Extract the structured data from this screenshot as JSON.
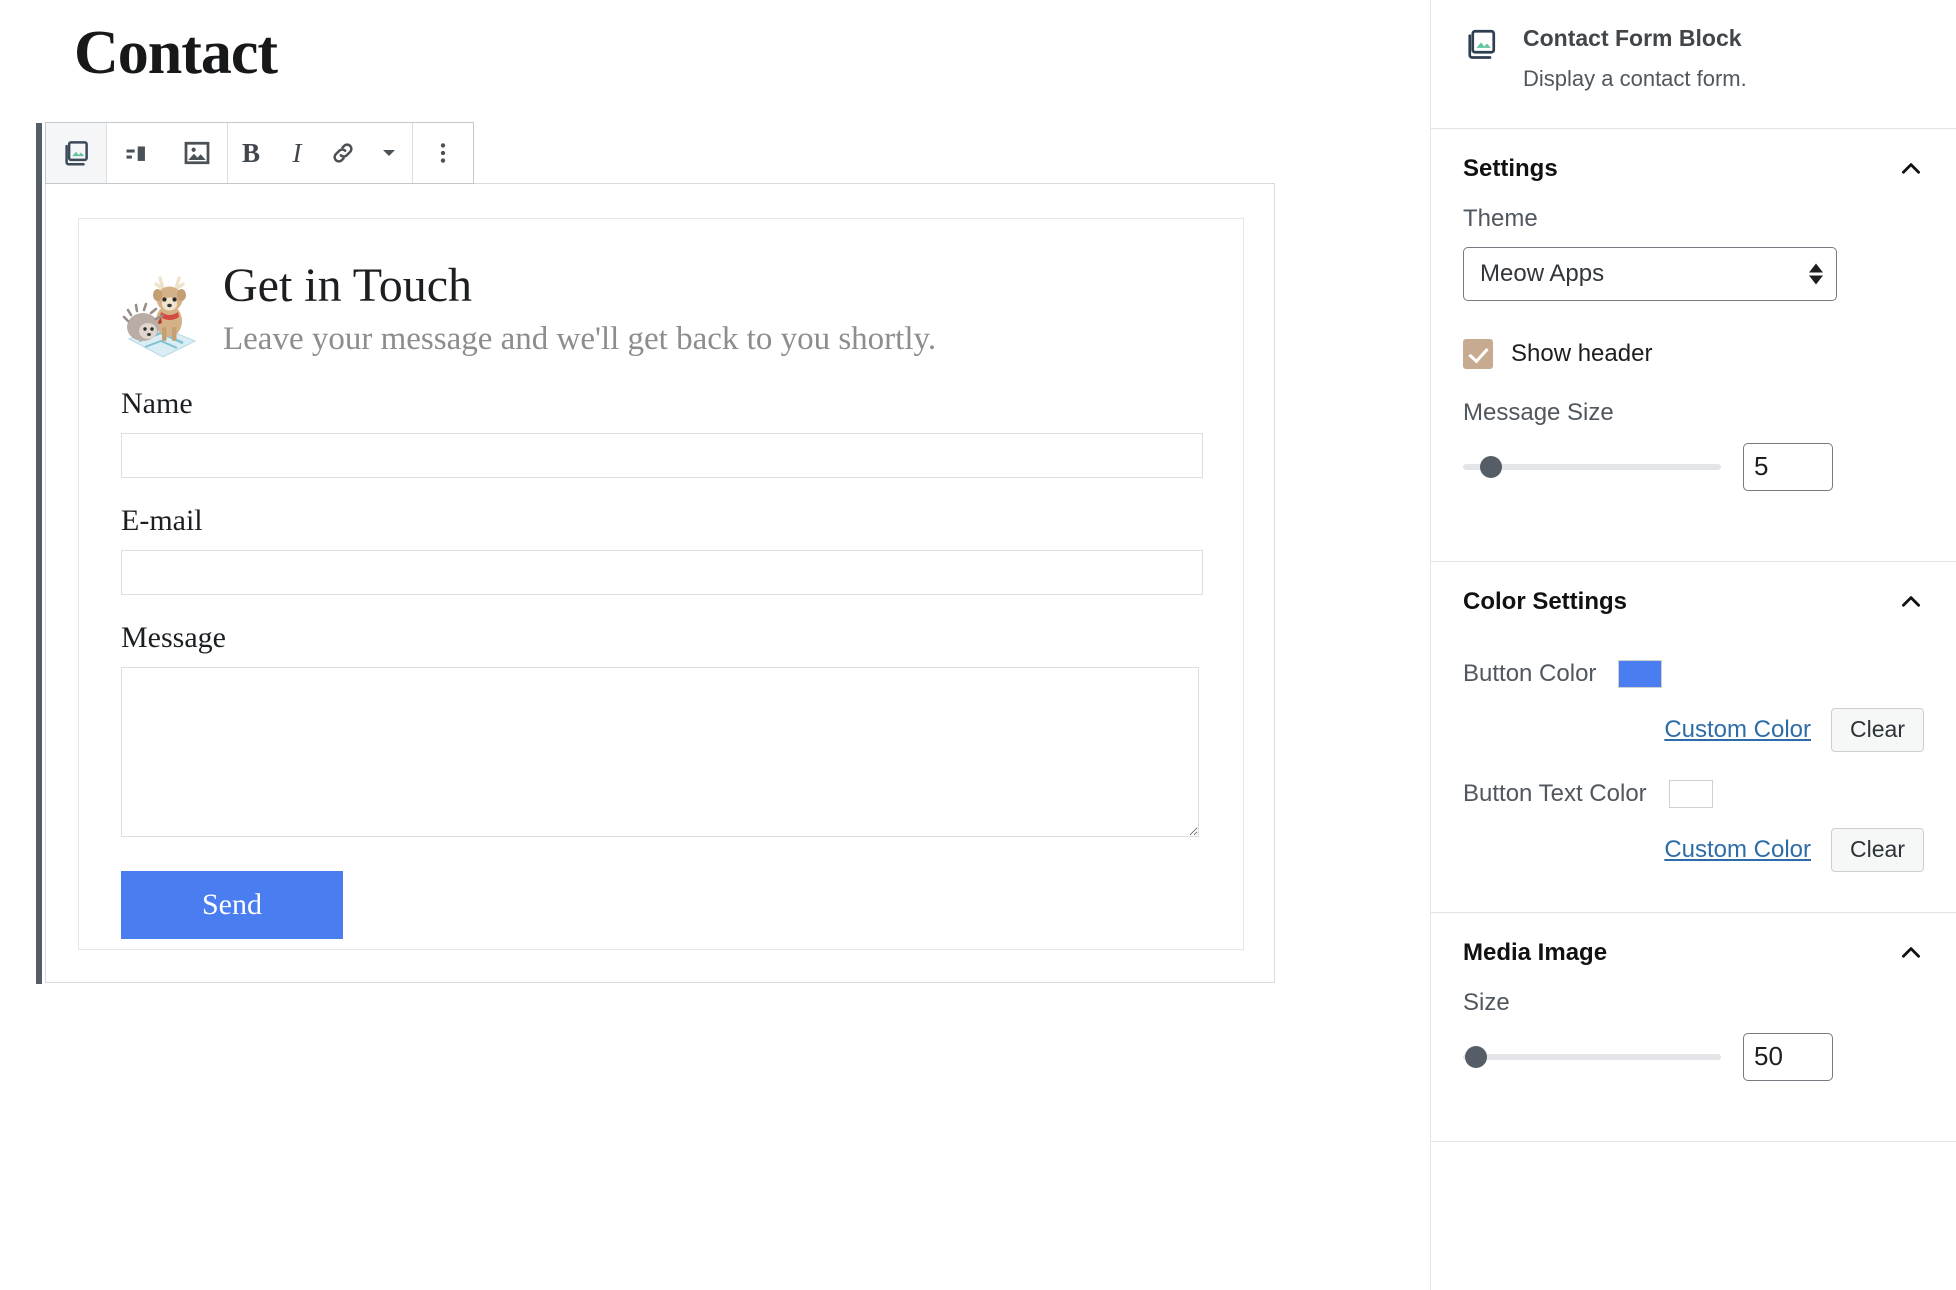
{
  "editor": {
    "post_title": "Contact",
    "toolbar": {
      "block_type_icon": "contact-form-block-icon",
      "items": [
        {
          "name": "block-type-button",
          "icon": "contact-form-block-icon",
          "label": "Contact Form Block"
        },
        {
          "name": "align-button",
          "icon": "align-left-icon",
          "label": "Change alignment"
        },
        {
          "name": "media-button",
          "icon": "image-icon",
          "label": "Media"
        },
        {
          "name": "bold-button",
          "icon": "bold-icon",
          "label": "B"
        },
        {
          "name": "italic-button",
          "icon": "italic-icon",
          "label": "I"
        },
        {
          "name": "link-button",
          "icon": "link-icon",
          "label": "Link"
        },
        {
          "name": "more-rich-text-button",
          "icon": "chevron-down-icon",
          "label": "More rich text controls"
        },
        {
          "name": "block-options-button",
          "icon": "ellipsis-vertical-icon",
          "label": "Options"
        }
      ]
    },
    "form_preview": {
      "mascot_icon": "hedgehog-deer-mascot",
      "title": "Get in Touch",
      "subtitle": "Leave your message and we'll get back to you shortly.",
      "fields": [
        {
          "name": "name-field",
          "label": "Name",
          "value": "",
          "placeholder": "",
          "type": "text"
        },
        {
          "name": "email-field",
          "label": "E-mail",
          "value": "",
          "placeholder": "",
          "type": "text"
        },
        {
          "name": "message-field",
          "label": "Message",
          "value": "",
          "placeholder": "",
          "type": "textarea"
        }
      ],
      "submit_label": "Send",
      "submit_bg": "#4a7ef0",
      "submit_text_color": "#ffffff"
    }
  },
  "sidebar": {
    "block_card": {
      "icon": "contact-form-block-icon",
      "title": "Contact Form Block",
      "description": "Display a contact form."
    },
    "panels": [
      {
        "name": "settings",
        "title": "Settings",
        "collapse_icon": "chevron-up-icon",
        "expanded": true
      },
      {
        "name": "color-settings",
        "title": "Color Settings",
        "collapse_icon": "chevron-up-icon",
        "expanded": true
      },
      {
        "name": "media-image",
        "title": "Media Image",
        "collapse_icon": "chevron-up-icon",
        "expanded": true
      }
    ],
    "settings": {
      "theme": {
        "label": "Theme",
        "value": "Meow Apps",
        "options": [
          "Meow Apps"
        ]
      },
      "show_header": {
        "label": "Show header",
        "checked": true,
        "check_color": "#c6ab90"
      },
      "message_size": {
        "label": "Message Size",
        "value": "5",
        "slider_percent": 11
      }
    },
    "color_settings": {
      "button_color": {
        "label": "Button Color",
        "swatch": "#4a7ef0",
        "custom_label": "Custom Color",
        "clear_label": "Clear"
      },
      "button_text_color": {
        "label": "Button Text Color",
        "swatch": "#ffffff",
        "custom_label": "Custom Color",
        "clear_label": "Clear"
      }
    },
    "media_image": {
      "size": {
        "label": "Size",
        "value": "50",
        "slider_percent": 5
      }
    }
  }
}
